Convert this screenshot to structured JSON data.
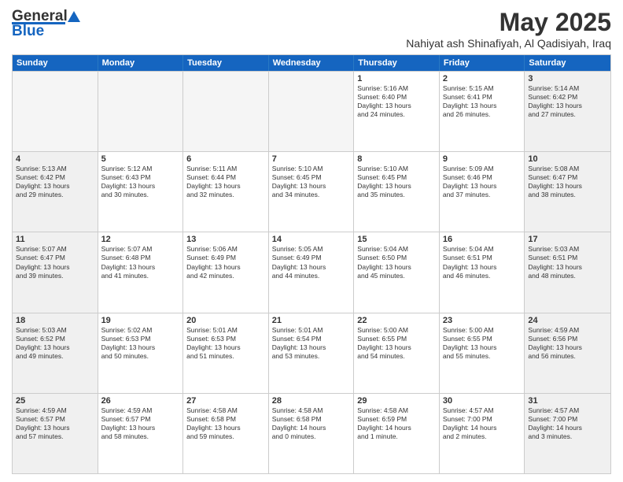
{
  "logo": {
    "line1": "General",
    "line2": "Blue"
  },
  "title": "May 2025",
  "subtitle": "Nahiyat ash Shinafiyah, Al Qadisiyah, Iraq",
  "days": [
    "Sunday",
    "Monday",
    "Tuesday",
    "Wednesday",
    "Thursday",
    "Friday",
    "Saturday"
  ],
  "rows": [
    [
      {
        "day": "",
        "empty": true,
        "lines": []
      },
      {
        "day": "",
        "empty": true,
        "lines": []
      },
      {
        "day": "",
        "empty": true,
        "lines": []
      },
      {
        "day": "",
        "empty": true,
        "lines": []
      },
      {
        "day": "1",
        "empty": false,
        "lines": [
          "Sunrise: 5:16 AM",
          "Sunset: 6:40 PM",
          "Daylight: 13 hours",
          "and 24 minutes."
        ]
      },
      {
        "day": "2",
        "empty": false,
        "lines": [
          "Sunrise: 5:15 AM",
          "Sunset: 6:41 PM",
          "Daylight: 13 hours",
          "and 26 minutes."
        ]
      },
      {
        "day": "3",
        "empty": false,
        "shaded": true,
        "lines": [
          "Sunrise: 5:14 AM",
          "Sunset: 6:42 PM",
          "Daylight: 13 hours",
          "and 27 minutes."
        ]
      }
    ],
    [
      {
        "day": "4",
        "empty": false,
        "shaded": true,
        "lines": [
          "Sunrise: 5:13 AM",
          "Sunset: 6:42 PM",
          "Daylight: 13 hours",
          "and 29 minutes."
        ]
      },
      {
        "day": "5",
        "empty": false,
        "lines": [
          "Sunrise: 5:12 AM",
          "Sunset: 6:43 PM",
          "Daylight: 13 hours",
          "and 30 minutes."
        ]
      },
      {
        "day": "6",
        "empty": false,
        "lines": [
          "Sunrise: 5:11 AM",
          "Sunset: 6:44 PM",
          "Daylight: 13 hours",
          "and 32 minutes."
        ]
      },
      {
        "day": "7",
        "empty": false,
        "lines": [
          "Sunrise: 5:10 AM",
          "Sunset: 6:45 PM",
          "Daylight: 13 hours",
          "and 34 minutes."
        ]
      },
      {
        "day": "8",
        "empty": false,
        "lines": [
          "Sunrise: 5:10 AM",
          "Sunset: 6:45 PM",
          "Daylight: 13 hours",
          "and 35 minutes."
        ]
      },
      {
        "day": "9",
        "empty": false,
        "lines": [
          "Sunrise: 5:09 AM",
          "Sunset: 6:46 PM",
          "Daylight: 13 hours",
          "and 37 minutes."
        ]
      },
      {
        "day": "10",
        "empty": false,
        "shaded": true,
        "lines": [
          "Sunrise: 5:08 AM",
          "Sunset: 6:47 PM",
          "Daylight: 13 hours",
          "and 38 minutes."
        ]
      }
    ],
    [
      {
        "day": "11",
        "empty": false,
        "shaded": true,
        "lines": [
          "Sunrise: 5:07 AM",
          "Sunset: 6:47 PM",
          "Daylight: 13 hours",
          "and 39 minutes."
        ]
      },
      {
        "day": "12",
        "empty": false,
        "lines": [
          "Sunrise: 5:07 AM",
          "Sunset: 6:48 PM",
          "Daylight: 13 hours",
          "and 41 minutes."
        ]
      },
      {
        "day": "13",
        "empty": false,
        "lines": [
          "Sunrise: 5:06 AM",
          "Sunset: 6:49 PM",
          "Daylight: 13 hours",
          "and 42 minutes."
        ]
      },
      {
        "day": "14",
        "empty": false,
        "lines": [
          "Sunrise: 5:05 AM",
          "Sunset: 6:49 PM",
          "Daylight: 13 hours",
          "and 44 minutes."
        ]
      },
      {
        "day": "15",
        "empty": false,
        "lines": [
          "Sunrise: 5:04 AM",
          "Sunset: 6:50 PM",
          "Daylight: 13 hours",
          "and 45 minutes."
        ]
      },
      {
        "day": "16",
        "empty": false,
        "lines": [
          "Sunrise: 5:04 AM",
          "Sunset: 6:51 PM",
          "Daylight: 13 hours",
          "and 46 minutes."
        ]
      },
      {
        "day": "17",
        "empty": false,
        "shaded": true,
        "lines": [
          "Sunrise: 5:03 AM",
          "Sunset: 6:51 PM",
          "Daylight: 13 hours",
          "and 48 minutes."
        ]
      }
    ],
    [
      {
        "day": "18",
        "empty": false,
        "shaded": true,
        "lines": [
          "Sunrise: 5:03 AM",
          "Sunset: 6:52 PM",
          "Daylight: 13 hours",
          "and 49 minutes."
        ]
      },
      {
        "day": "19",
        "empty": false,
        "lines": [
          "Sunrise: 5:02 AM",
          "Sunset: 6:53 PM",
          "Daylight: 13 hours",
          "and 50 minutes."
        ]
      },
      {
        "day": "20",
        "empty": false,
        "lines": [
          "Sunrise: 5:01 AM",
          "Sunset: 6:53 PM",
          "Daylight: 13 hours",
          "and 51 minutes."
        ]
      },
      {
        "day": "21",
        "empty": false,
        "lines": [
          "Sunrise: 5:01 AM",
          "Sunset: 6:54 PM",
          "Daylight: 13 hours",
          "and 53 minutes."
        ]
      },
      {
        "day": "22",
        "empty": false,
        "lines": [
          "Sunrise: 5:00 AM",
          "Sunset: 6:55 PM",
          "Daylight: 13 hours",
          "and 54 minutes."
        ]
      },
      {
        "day": "23",
        "empty": false,
        "lines": [
          "Sunrise: 5:00 AM",
          "Sunset: 6:55 PM",
          "Daylight: 13 hours",
          "and 55 minutes."
        ]
      },
      {
        "day": "24",
        "empty": false,
        "shaded": true,
        "lines": [
          "Sunrise: 4:59 AM",
          "Sunset: 6:56 PM",
          "Daylight: 13 hours",
          "and 56 minutes."
        ]
      }
    ],
    [
      {
        "day": "25",
        "empty": false,
        "shaded": true,
        "lines": [
          "Sunrise: 4:59 AM",
          "Sunset: 6:57 PM",
          "Daylight: 13 hours",
          "and 57 minutes."
        ]
      },
      {
        "day": "26",
        "empty": false,
        "lines": [
          "Sunrise: 4:59 AM",
          "Sunset: 6:57 PM",
          "Daylight: 13 hours",
          "and 58 minutes."
        ]
      },
      {
        "day": "27",
        "empty": false,
        "lines": [
          "Sunrise: 4:58 AM",
          "Sunset: 6:58 PM",
          "Daylight: 13 hours",
          "and 59 minutes."
        ]
      },
      {
        "day": "28",
        "empty": false,
        "lines": [
          "Sunrise: 4:58 AM",
          "Sunset: 6:58 PM",
          "Daylight: 14 hours",
          "and 0 minutes."
        ]
      },
      {
        "day": "29",
        "empty": false,
        "lines": [
          "Sunrise: 4:58 AM",
          "Sunset: 6:59 PM",
          "Daylight: 14 hours",
          "and 1 minute."
        ]
      },
      {
        "day": "30",
        "empty": false,
        "lines": [
          "Sunrise: 4:57 AM",
          "Sunset: 7:00 PM",
          "Daylight: 14 hours",
          "and 2 minutes."
        ]
      },
      {
        "day": "31",
        "empty": false,
        "shaded": true,
        "lines": [
          "Sunrise: 4:57 AM",
          "Sunset: 7:00 PM",
          "Daylight: 14 hours",
          "and 3 minutes."
        ]
      }
    ]
  ]
}
